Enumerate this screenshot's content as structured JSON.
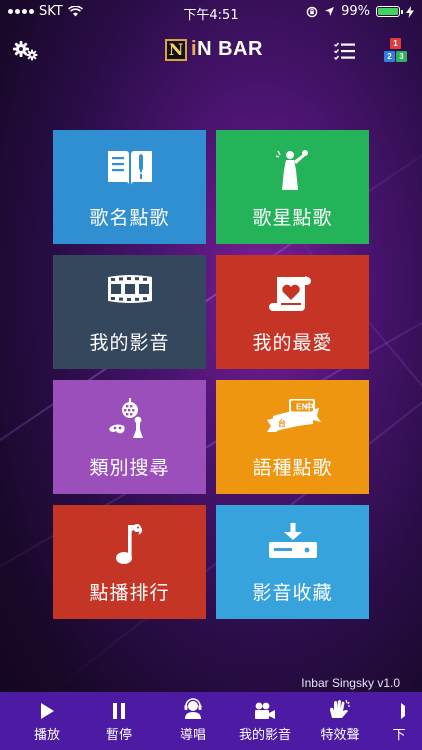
{
  "status_bar": {
    "carrier": "SKT",
    "time": "下午4:51",
    "battery_percent": "99%",
    "battery_level": 0.99,
    "battery_color": "#3fd45b"
  },
  "header": {
    "logo_letter": "N",
    "logo_i": "i",
    "logo_rest": "N BAR",
    "number_blocks": [
      "1",
      "2",
      "3"
    ],
    "icons": [
      "gear-icon",
      "list-icon",
      "number-blocks-icon"
    ]
  },
  "tiles": [
    {
      "label": "歌名點歌",
      "icon": "songbook-icon",
      "color": "#2f8fd0"
    },
    {
      "label": "歌星點歌",
      "icon": "singer-icon",
      "color": "#25b35a"
    },
    {
      "label": "我的影音",
      "icon": "film-strip-icon",
      "color": "#35475c"
    },
    {
      "label": "我的最愛",
      "icon": "heart-scroll-icon",
      "color": "#c63425"
    },
    {
      "label": "類別搜尋",
      "icon": "disco-mask-icon",
      "color": "#9b4fbb"
    },
    {
      "label": "語種點歌",
      "icon": "language-ribbon-icon",
      "color": "#ee9610"
    },
    {
      "label": "點播排行",
      "icon": "music-note-icon",
      "color": "#c43526"
    },
    {
      "label": "影音收藏",
      "icon": "download-box-icon",
      "color": "#36a3dd"
    }
  ],
  "language_badges": {
    "a": "EN",
    "b": "中",
    "c": "台"
  },
  "version": "Inbar Singsky v1.0",
  "tab_bar": {
    "background": "#4d1aa3",
    "items": [
      {
        "label": "播放",
        "icon": "play-icon"
      },
      {
        "label": "暫停",
        "icon": "pause-icon"
      },
      {
        "label": "導唱",
        "icon": "guide-singer-icon"
      },
      {
        "label": "我的影音",
        "icon": "video-camera-icon"
      },
      {
        "label": "特效聲",
        "icon": "clap-icon"
      },
      {
        "label": "下",
        "icon": "next-icon"
      }
    ]
  }
}
